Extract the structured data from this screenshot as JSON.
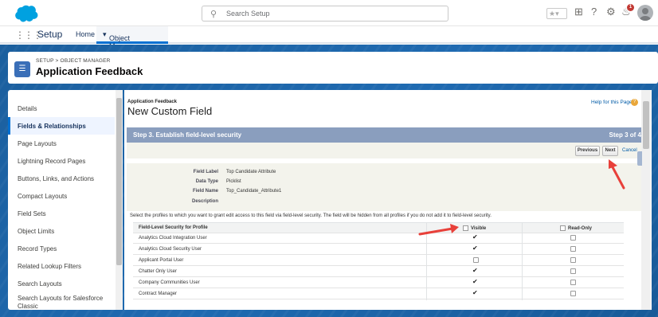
{
  "header": {
    "search_placeholder": "Search Setup",
    "notification_count": "1"
  },
  "nav": {
    "app_name": "Setup",
    "home": "Home",
    "object_manager": "Object Manager"
  },
  "page_header": {
    "breadcrumb": "SETUP > OBJECT MANAGER",
    "title": "Application Feedback"
  },
  "sidebar": {
    "items": [
      {
        "label": "Details"
      },
      {
        "label": "Fields & Relationships"
      },
      {
        "label": "Page Layouts"
      },
      {
        "label": "Lightning Record Pages"
      },
      {
        "label": "Buttons, Links, and Actions"
      },
      {
        "label": "Compact Layouts"
      },
      {
        "label": "Field Sets"
      },
      {
        "label": "Object Limits"
      },
      {
        "label": "Record Types"
      },
      {
        "label": "Related Lookup Filters"
      },
      {
        "label": "Search Layouts"
      },
      {
        "label": "Search Layouts for Salesforce Classic"
      }
    ]
  },
  "main": {
    "object_label": "Application Feedback",
    "page_title": "New Custom Field",
    "help_link": "Help for this Page",
    "step_title": "Step 3. Establish field-level security",
    "step_counter": "Step 3 of 4",
    "buttons": {
      "previous": "Previous",
      "next": "Next",
      "cancel": "Cancel"
    },
    "field_info": {
      "label_label": "Field Label",
      "label_value": "Top Candidate Attribute",
      "type_label": "Data Type",
      "type_value": "Picklist",
      "name_label": "Field Name",
      "name_value": "Top_Candidate_Attribute1",
      "desc_label": "Description"
    },
    "instructions": "Select the profiles to which you want to grant edit access to this field via field-level security. The field will be hidden from all profiles if you do not add it to field-level security.",
    "table": {
      "col_profile": "Field-Level Security for Profile",
      "col_visible": "Visible",
      "col_readonly": "Read-Only",
      "rows": [
        {
          "profile": "Analytics Cloud Integration User",
          "visible": true,
          "read_only": false
        },
        {
          "profile": "Analytics Cloud Security User",
          "visible": true,
          "read_only": false
        },
        {
          "profile": "Applicant Portal User",
          "visible": false,
          "read_only": false
        },
        {
          "profile": "Chatter Only User",
          "visible": true,
          "read_only": false
        },
        {
          "profile": "Company Communities User",
          "visible": true,
          "read_only": false
        },
        {
          "profile": "Contract Manager",
          "visible": true,
          "read_only": false
        }
      ]
    }
  },
  "colors": {
    "annotation_arrow": "#e8403a",
    "brand": "#00a1e0",
    "step_header": "#8a9ebe"
  }
}
